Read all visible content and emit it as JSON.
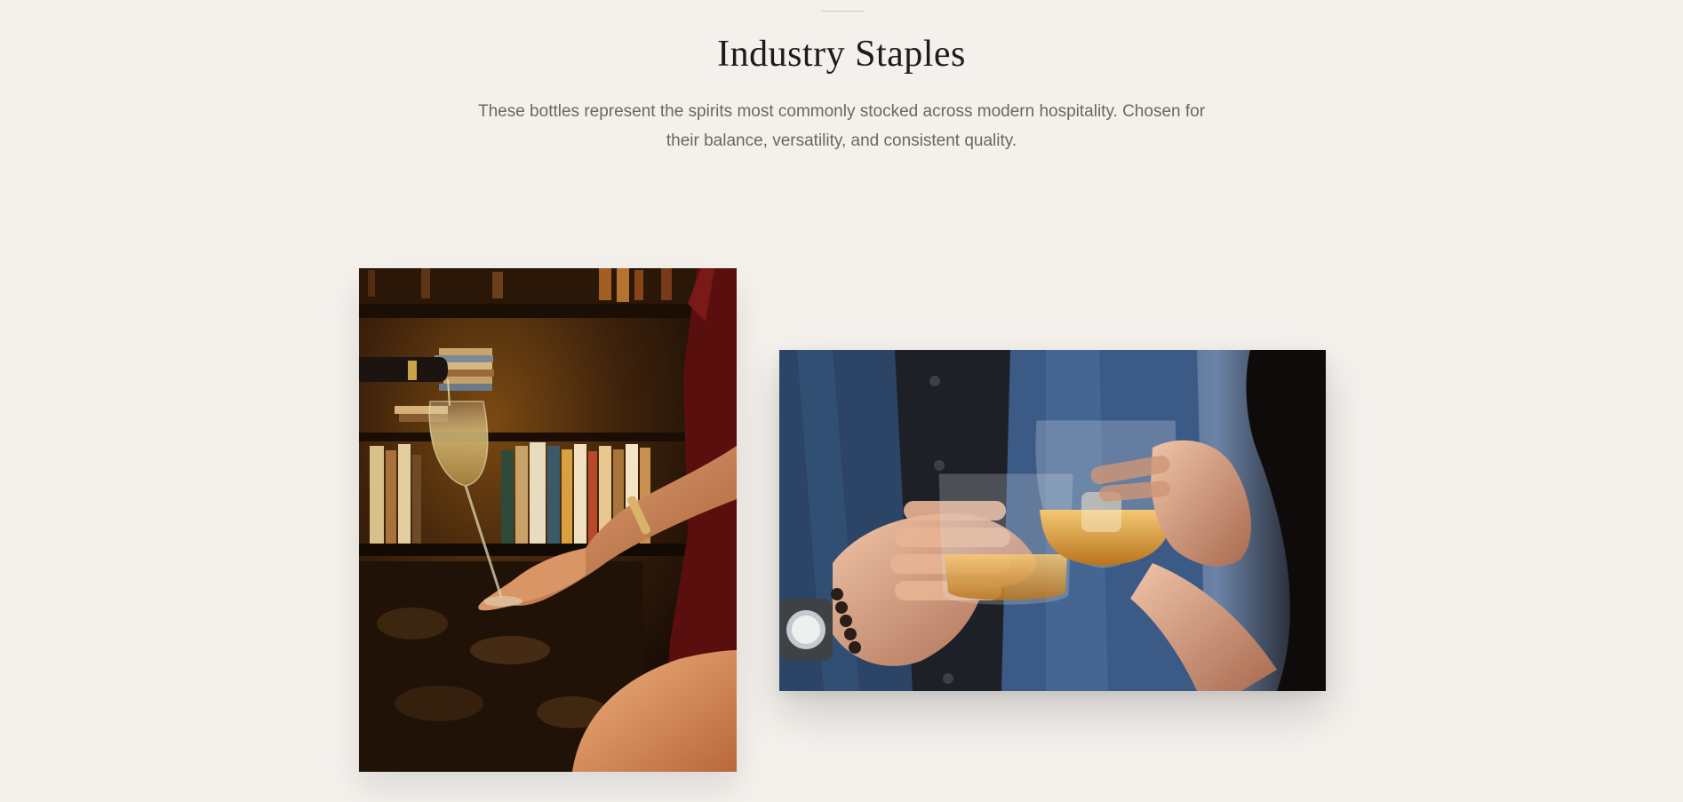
{
  "section": {
    "title": "Industry Staples",
    "description": "These bottles represent the spirits most commonly stocked across modern hospitality. Chosen for their balance, versatility, and consistent quality."
  },
  "images": [
    {
      "name": "champagne-pour-photo",
      "subject": "champagne being poured into a flute in front of a bookshelf"
    },
    {
      "name": "whiskey-toast-photo",
      "subject": "two hands toasting glasses of whiskey on ice"
    }
  ],
  "colors": {
    "background": "#f4f1ed",
    "heading": "#1e1b18",
    "body_text": "#6c6660",
    "divider": "#d8c6a8"
  }
}
